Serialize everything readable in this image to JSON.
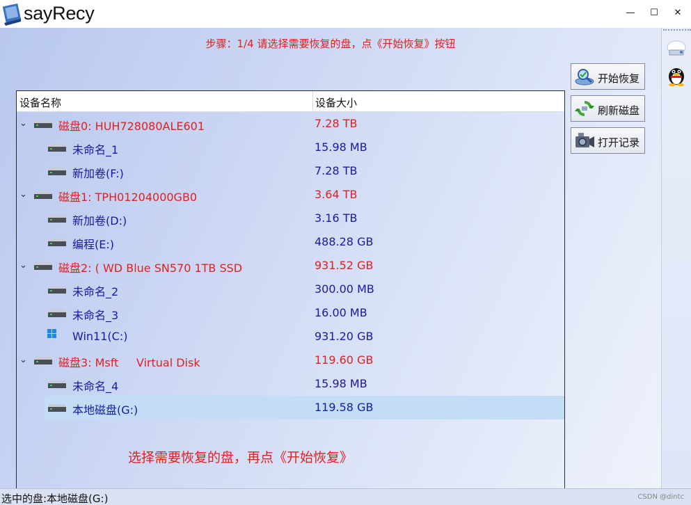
{
  "window": {
    "title": "sayRecy",
    "minimize_symbol": "—",
    "maximize_symbol": "☐",
    "close_symbol": "✕"
  },
  "step_text": "步骤：1/4 请选择需要恢复的盘，点《开始恢复》按钮",
  "tree": {
    "columns": {
      "name": "设备名称",
      "size": "设备大小"
    },
    "rows": [
      {
        "kind": "disk",
        "label": "磁盘0: HUH728080ALE601",
        "size": "7.28 TB",
        "icon": "hard-drive-icon"
      },
      {
        "kind": "part",
        "label": "未命名_1",
        "size": "15.98 MB",
        "icon": "hard-drive-icon"
      },
      {
        "kind": "part",
        "label": "新加卷(F:)",
        "size": "7.28 TB",
        "icon": "hard-drive-icon"
      },
      {
        "kind": "disk",
        "label": "磁盘1: TPH01204000GB0",
        "size": "3.64 TB",
        "icon": "hard-drive-icon"
      },
      {
        "kind": "part",
        "label": "新加卷(D:)",
        "size": "3.16 TB",
        "icon": "hard-drive-icon"
      },
      {
        "kind": "part",
        "label": "编程(E:)",
        "size": "488.28 GB",
        "icon": "hard-drive-icon"
      },
      {
        "kind": "disk",
        "label": "磁盘2: ( WD Blue SN570 1TB SSD",
        "size": "931.52 GB",
        "icon": "hard-drive-icon"
      },
      {
        "kind": "part",
        "label": "未命名_2",
        "size": "300.00 MB",
        "icon": "hard-drive-icon"
      },
      {
        "kind": "part",
        "label": "未命名_3",
        "size": "16.00 MB",
        "icon": "hard-drive-icon"
      },
      {
        "kind": "part",
        "label": "Win11(C:)",
        "size": "931.20 GB",
        "icon": "windows-logo-icon"
      },
      {
        "kind": "disk",
        "label": "磁盘3: Msft     Virtual Disk",
        "size": "119.60 GB",
        "icon": "hard-drive-icon"
      },
      {
        "kind": "part",
        "label": "未命名_4",
        "size": "15.98 MB",
        "icon": "hard-drive-icon"
      },
      {
        "kind": "part",
        "label": "本地磁盘(G:)",
        "size": "119.58 GB",
        "icon": "hard-drive-icon",
        "selected": true
      }
    ]
  },
  "hint_text": "选择需要恢复的盘，再点《开始恢复》",
  "buttons": {
    "start_recovery": "开始恢复",
    "refresh_disks": "刷新磁盘",
    "open_records": "打开记录"
  },
  "status": {
    "selected_text": "选中的盘:本地磁盘(G:)",
    "watermark": "CSDN @dintc"
  },
  "colors": {
    "disk_text": "#e02020",
    "partition_text": "#1a1aa0",
    "selection": "#c4ddf6"
  }
}
